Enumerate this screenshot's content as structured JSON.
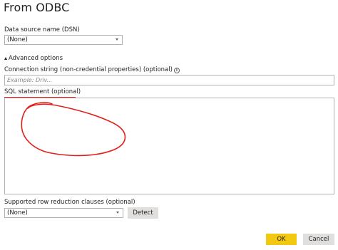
{
  "dialog": {
    "title": "From ODBC"
  },
  "dsn": {
    "label": "Data source name (DSN)",
    "selected": "(None)"
  },
  "advanced": {
    "toggle_label": "Advanced options",
    "expanded": true
  },
  "connection_string": {
    "label": "Connection string (non-credential properties) (optional)",
    "info_icon": "i",
    "placeholder": "Example: Driv...",
    "value": ""
  },
  "sql_statement": {
    "label": "SQL statement (optional)",
    "value": ""
  },
  "row_reduction": {
    "label": "Supported row reduction clauses (optional)",
    "selected": "(None)",
    "detect_label": "Detect"
  },
  "footer": {
    "ok_label": "OK",
    "cancel_label": "Cancel"
  },
  "colors": {
    "accent_ok": "#f2c811",
    "annotation_red": "#e0201b",
    "border": "#b3b0ad",
    "secondary_button": "#e1dfdd"
  }
}
